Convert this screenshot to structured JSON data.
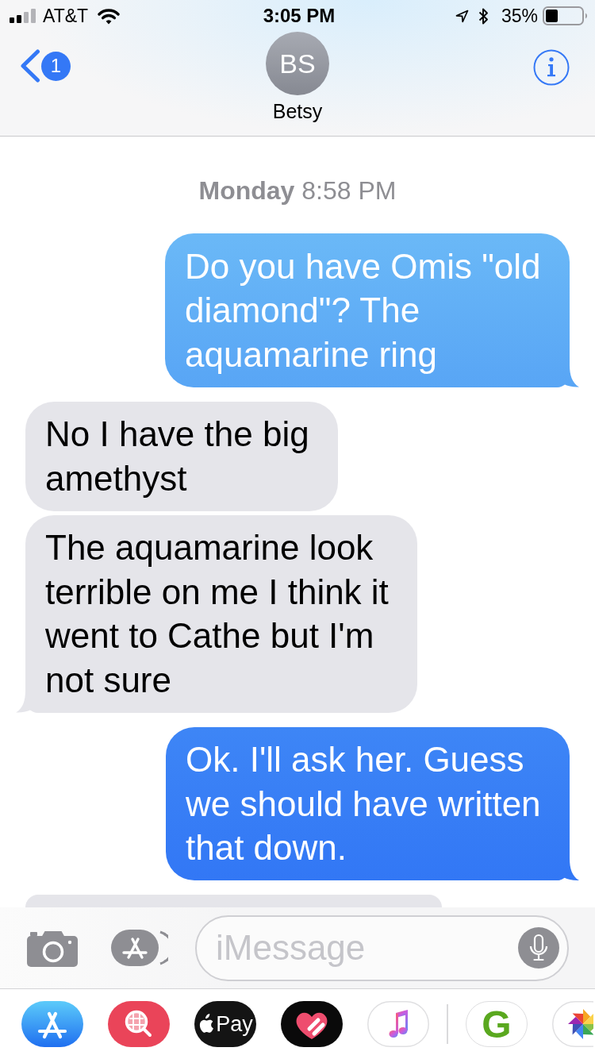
{
  "status_bar": {
    "carrier": "AT&T",
    "time": "3:05 PM",
    "battery": "35%"
  },
  "nav_bar": {
    "unread_count": "1",
    "contact": {
      "initials": "BS",
      "name": "Betsy"
    }
  },
  "conversation": {
    "timestamp": "**Monday** 8:58 PM",
    "messages": [
      {
        "kind": "sent",
        "text": "Do you have Omis \"old diamond\"? The aquamarine ring",
        "tail": true
      },
      {
        "kind": "received",
        "text": "No I have the big amethyst",
        "tail": false
      },
      {
        "kind": "received",
        "text": "The aquamarine look terrible on me I think it went to Cathe but I'm not sure",
        "tail": true
      },
      {
        "kind": "sent",
        "text": "Ok. I'll ask her. Guess we should have written that down.",
        "tail": true
      },
      {
        "kind": "received"
      }
    ]
  },
  "compose_bar": {
    "placeholder": "iMessage"
  },
  "app_drawer": {
    "recent": [
      {
        "kind": "store"
      },
      {
        "kind": "image_search"
      },
      {
        "kind": "pay",
        "label": "Pay"
      },
      {
        "kind": "digital_touch"
      },
      {
        "kind": "music"
      }
    ],
    "more": [
      {
        "kind": "letter",
        "label": "G"
      },
      {
        "kind": "photos"
      }
    ]
  }
}
